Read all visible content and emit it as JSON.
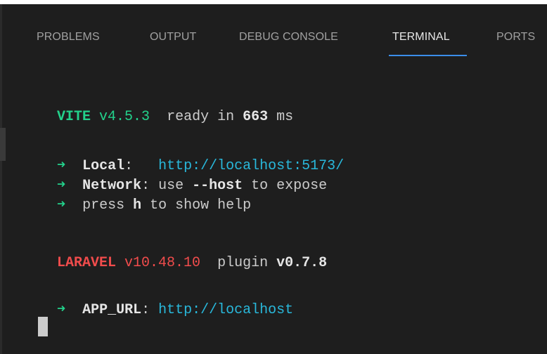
{
  "panel": {
    "tabs": [
      {
        "label": "PROBLEMS",
        "active": false
      },
      {
        "label": "OUTPUT",
        "active": false
      },
      {
        "label": "DEBUG CONSOLE",
        "active": false
      },
      {
        "label": "TERMINAL",
        "active": true
      },
      {
        "label": "PORTS",
        "active": false
      }
    ]
  },
  "terminal": {
    "vite": {
      "name": "VITE",
      "version": "v4.5.3",
      "ready_prefix": "ready in",
      "ready_ms": "663",
      "ready_unit": "ms"
    },
    "local": {
      "arrow": "➜",
      "label": "Local",
      "colon": ":",
      "url": "http://localhost:5173/"
    },
    "network": {
      "arrow": "➜",
      "label": "Network",
      "text1": ": use ",
      "flag": "--host",
      "text2": " to expose"
    },
    "help": {
      "arrow": "➜",
      "text1": "press ",
      "key": "h",
      "text2": " to show help"
    },
    "laravel": {
      "name": "LARAVEL",
      "version": "v10.48.10",
      "plugin_label": "plugin",
      "plugin_version": "v0.7.8"
    },
    "app_url": {
      "arrow": "➜",
      "label": "APP_URL",
      "colon": ":",
      "url": "http://localhost"
    }
  },
  "colors": {
    "background": "#1e1e1e",
    "green": "#23d18b",
    "red": "#f14c4c",
    "cyan": "#29b8db",
    "tab_underline": "#3b8eea"
  }
}
